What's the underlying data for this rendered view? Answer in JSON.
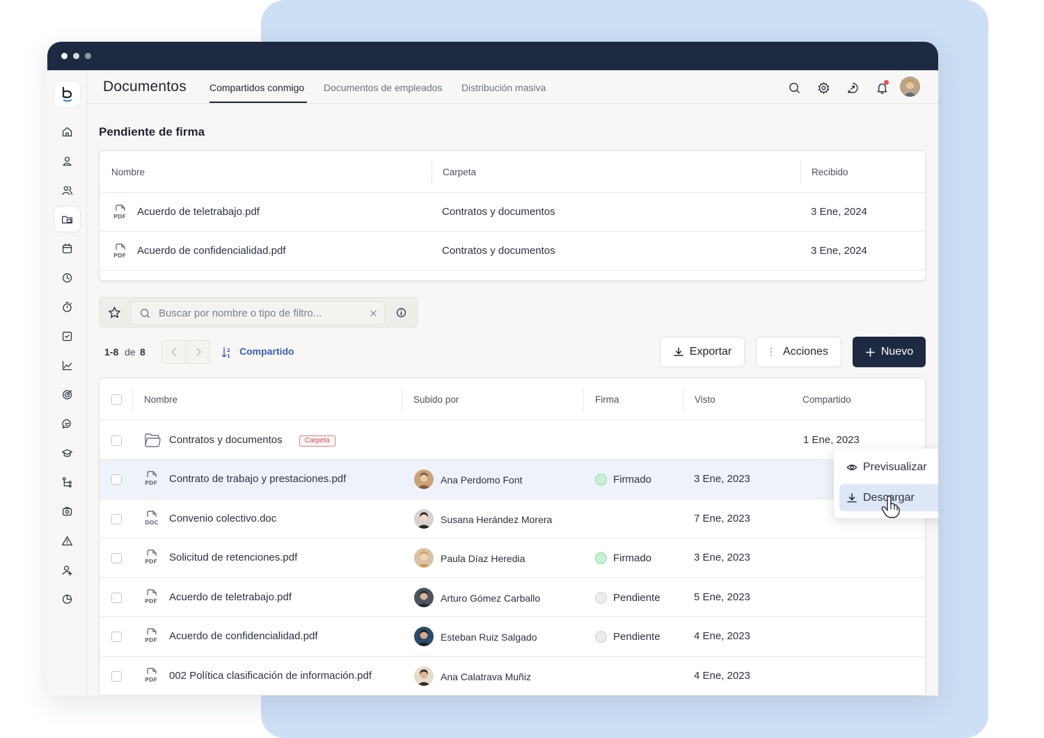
{
  "app": {
    "page_title": "Documentos"
  },
  "tabs": [
    {
      "label": "Compartidos conmigo",
      "active": true
    },
    {
      "label": "Documentos de empleados",
      "active": false
    },
    {
      "label": "Distribución masiva",
      "active": false
    }
  ],
  "pending": {
    "title": "Pendiente de firma",
    "columns": [
      "Nombre",
      "Carpeta",
      "Recibido"
    ],
    "rows": [
      {
        "file_type": "PDF",
        "name": "Acuerdo de teletrabajo.pdf",
        "folder": "Contratos y documentos",
        "received": "3 Ene, 2024"
      },
      {
        "file_type": "PDF",
        "name": "Acuerdo de confidencialidad.pdf",
        "folder": "Contratos y documentos",
        "received": "3 Ene, 2024"
      }
    ]
  },
  "search": {
    "placeholder": "Buscar por nombre o tipo de filtro..."
  },
  "pager": {
    "range": "1-8",
    "of": "de",
    "total": "8"
  },
  "sort": {
    "label": "Compartido"
  },
  "actions": {
    "export": "Exportar",
    "actions": "Acciones",
    "new": "Nuevo"
  },
  "docs": {
    "columns": [
      "Nombre",
      "Subido por",
      "Firma",
      "Visto",
      "Compartido"
    ],
    "folder_row": {
      "name": "Contratos y documentos",
      "badge": "Carpeta",
      "shared": "1 Ene, 2023"
    },
    "rows": [
      {
        "file_type": "PDF",
        "name": "Contrato de trabajo y prestaciones.pdf",
        "uploader": "Ana Perdomo Font",
        "sign": "Firmado",
        "sign_state": "signed",
        "seen": "3 Ene, 2023"
      },
      {
        "file_type": "DOC",
        "name": "Convenio colectivo.doc",
        "uploader": "Susana Herández Morera",
        "sign": "",
        "sign_state": "none",
        "seen": "7 Ene, 2023"
      },
      {
        "file_type": "PDF",
        "name": "Solicitud de retenciones.pdf",
        "uploader": "Paula Díaz Heredia",
        "sign": "Firmado",
        "sign_state": "signed",
        "seen": "3 Ene, 2023"
      },
      {
        "file_type": "PDF",
        "name": "Acuerdo de teletrabajo.pdf",
        "uploader": "Arturo Gómez Carballo",
        "sign": "Pendiente",
        "sign_state": "pending",
        "seen": "5 Ene, 2023"
      },
      {
        "file_type": "PDF",
        "name": "Acuerdo de confidencialidad.pdf",
        "uploader": "Esteban Ruiz Salgado",
        "sign": "Pendiente",
        "sign_state": "pending",
        "seen": "4 Ene, 2023"
      },
      {
        "file_type": "PDF",
        "name": "002 Política clasificación de información.pdf",
        "uploader": "Ana Calatrava Muñiz",
        "sign": "",
        "sign_state": "none",
        "seen": "4 Ene, 2023"
      }
    ]
  },
  "context_menu": {
    "preview": "Previsualizar",
    "download": "Descargar"
  },
  "colors": {
    "primary": "#1d2a42",
    "accent_link": "#3a5bbf",
    "signed": "#c9f0d6",
    "pending": "#ececec",
    "menu_hover": "#dde7f7",
    "background_panel": "#cddff5"
  }
}
